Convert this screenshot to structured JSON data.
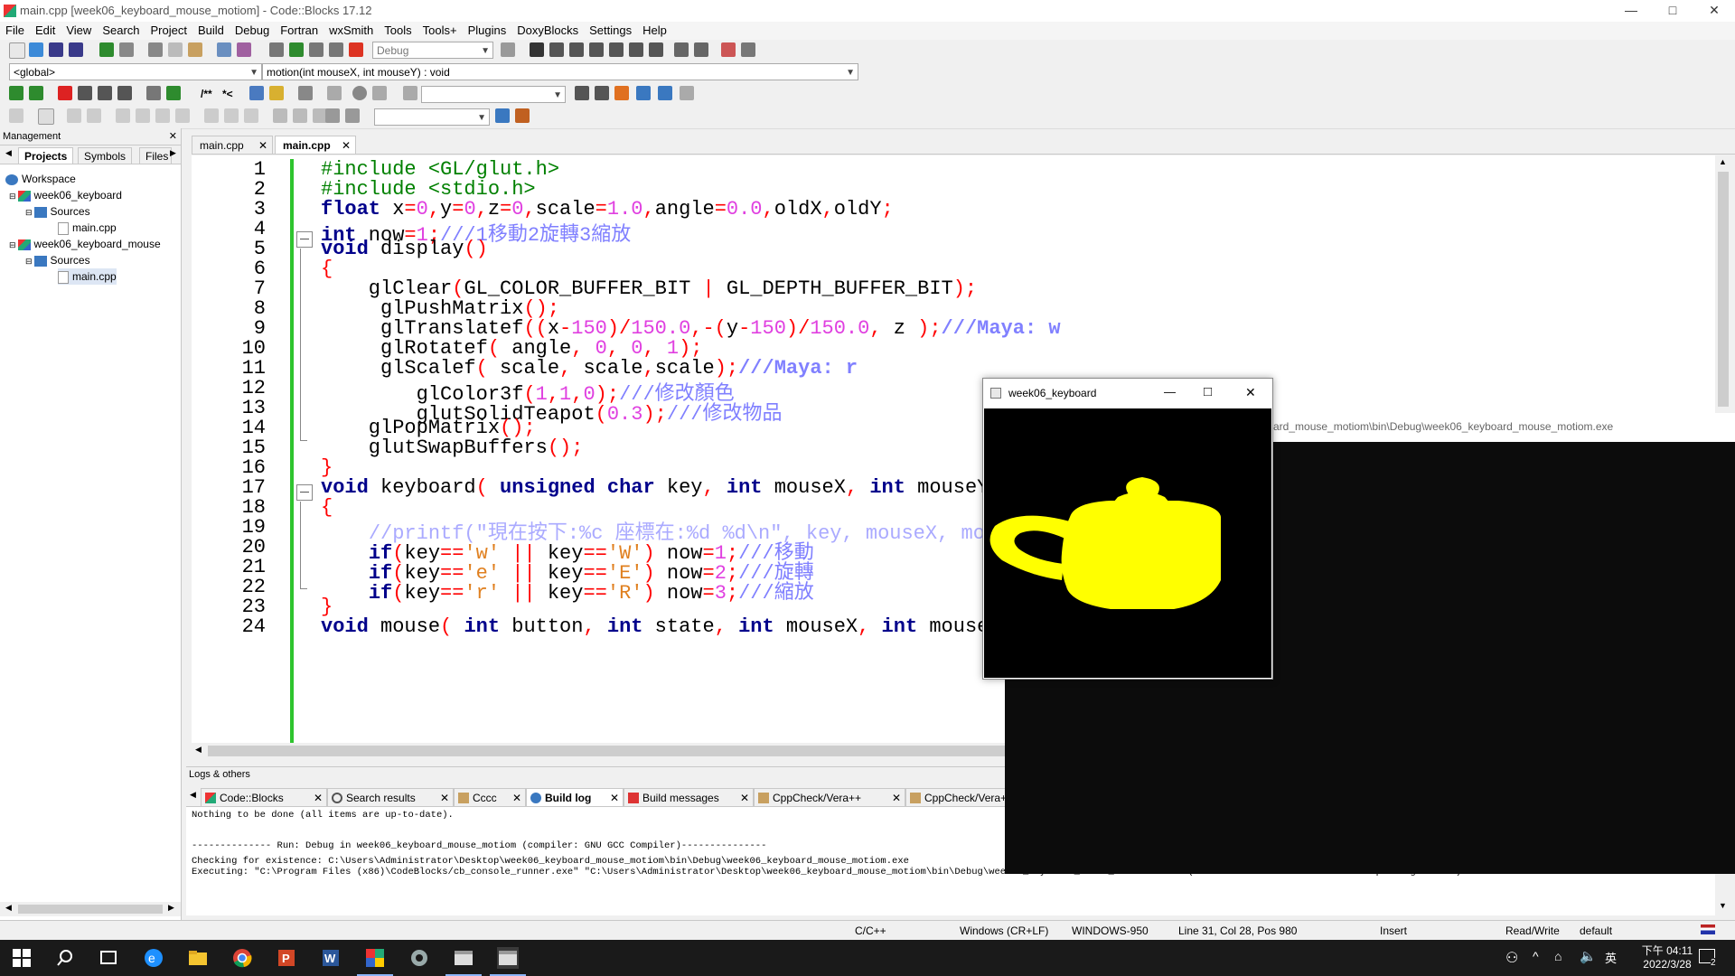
{
  "window": {
    "title": "main.cpp [week06_keyboard_mouse_motiom] - Code::Blocks 17.12",
    "min": "—",
    "max": "□",
    "close": "✕"
  },
  "menu": [
    "File",
    "Edit",
    "View",
    "Search",
    "Project",
    "Build",
    "Debug",
    "Fortran",
    "wxSmith",
    "Tools",
    "Tools+",
    "Plugins",
    "DoxyBlocks",
    "Settings",
    "Help"
  ],
  "toolbar": {
    "build_target": "Debug",
    "scope": "<global>",
    "function": "motion(int mouseX, int mouseY) : void",
    "doc_comment": "/**",
    "doc_inline": "*<"
  },
  "management": {
    "title": "Management",
    "close": "✕",
    "tabs": [
      "Projects",
      "Symbols",
      "Files"
    ],
    "tree": {
      "workspace": "Workspace",
      "projects": [
        {
          "name": "week06_keyboard",
          "folder": "Sources",
          "file": "main.cpp"
        },
        {
          "name": "week06_keyboard_mouse",
          "folder": "Sources",
          "file": "main.cpp"
        }
      ]
    }
  },
  "editor": {
    "tabs": [
      {
        "label": "main.cpp",
        "close": "✕"
      },
      {
        "label": "main.cpp",
        "close": "✕"
      }
    ],
    "line_numbers": [
      "1",
      "2",
      "3",
      "4",
      "5",
      "6",
      "7",
      "8",
      "9",
      "10",
      "11",
      "12",
      "13",
      "14",
      "15",
      "16",
      "17",
      "18",
      "19",
      "20",
      "21",
      "22",
      "23",
      "24"
    ]
  },
  "logs": {
    "title": "Logs & others",
    "tabs": [
      {
        "label": "Code::Blocks",
        "close": "✕"
      },
      {
        "label": "Search results",
        "close": "✕"
      },
      {
        "label": "Cccc",
        "close": "✕"
      },
      {
        "label": "Build log",
        "close": "✕"
      },
      {
        "label": "Build messages",
        "close": "✕"
      },
      {
        "label": "CppCheck/Vera++",
        "close": "✕"
      },
      {
        "label": "CppCheck/Vera++ messages",
        "close": "✕"
      }
    ],
    "lines": [
      "Nothing to be done (all items are up-to-date).",
      "",
      "",
      "-------------- Run: Debug in week06_keyboard_mouse_motiom (compiler: GNU GCC Compiler)---------------",
      "Checking for existence: C:\\Users\\Administrator\\Desktop\\week06_keyboard_mouse_motiom\\bin\\Debug\\week06_keyboard_mouse_motiom.exe",
      "Executing: \"C:\\Program Files (x86)\\CodeBlocks/cb_console_runner.exe\" \"C:\\Users\\Administrator\\Desktop\\week06_keyboard_mouse_motiom\\bin\\Debug\\week06_keyboard_mouse_motiom.exe\"  (in C:\\Users\\Administrator\\Desktop\\freeglut\\bin)"
    ]
  },
  "statusbar": {
    "language": "C/C++",
    "eol": "Windows (CR+LF)",
    "encoding": "WINDOWS-950",
    "position": "Line 31, Col 28, Pos 980",
    "mode": "Insert",
    "access": "Read/Write",
    "profile": "default"
  },
  "console": {
    "title": "C:\\Users\\Administrator\\Desktop\\week06_keyboard_mouse_motiom\\bin\\Debug\\week06_keyboard_mouse_motiom.exe",
    "title_visible": "ard_mouse_motiom\\bin\\Debug\\week06_keyboard_mouse_motiom.exe"
  },
  "glut_window": {
    "title": "week06_keyboard",
    "min": "—",
    "max": "□",
    "close": "✕",
    "teapot_color": "#ffff00"
  },
  "taskbar": {
    "time": "下午 04:11",
    "date": "2022/3/28",
    "ime": "英",
    "notifications": "2"
  }
}
